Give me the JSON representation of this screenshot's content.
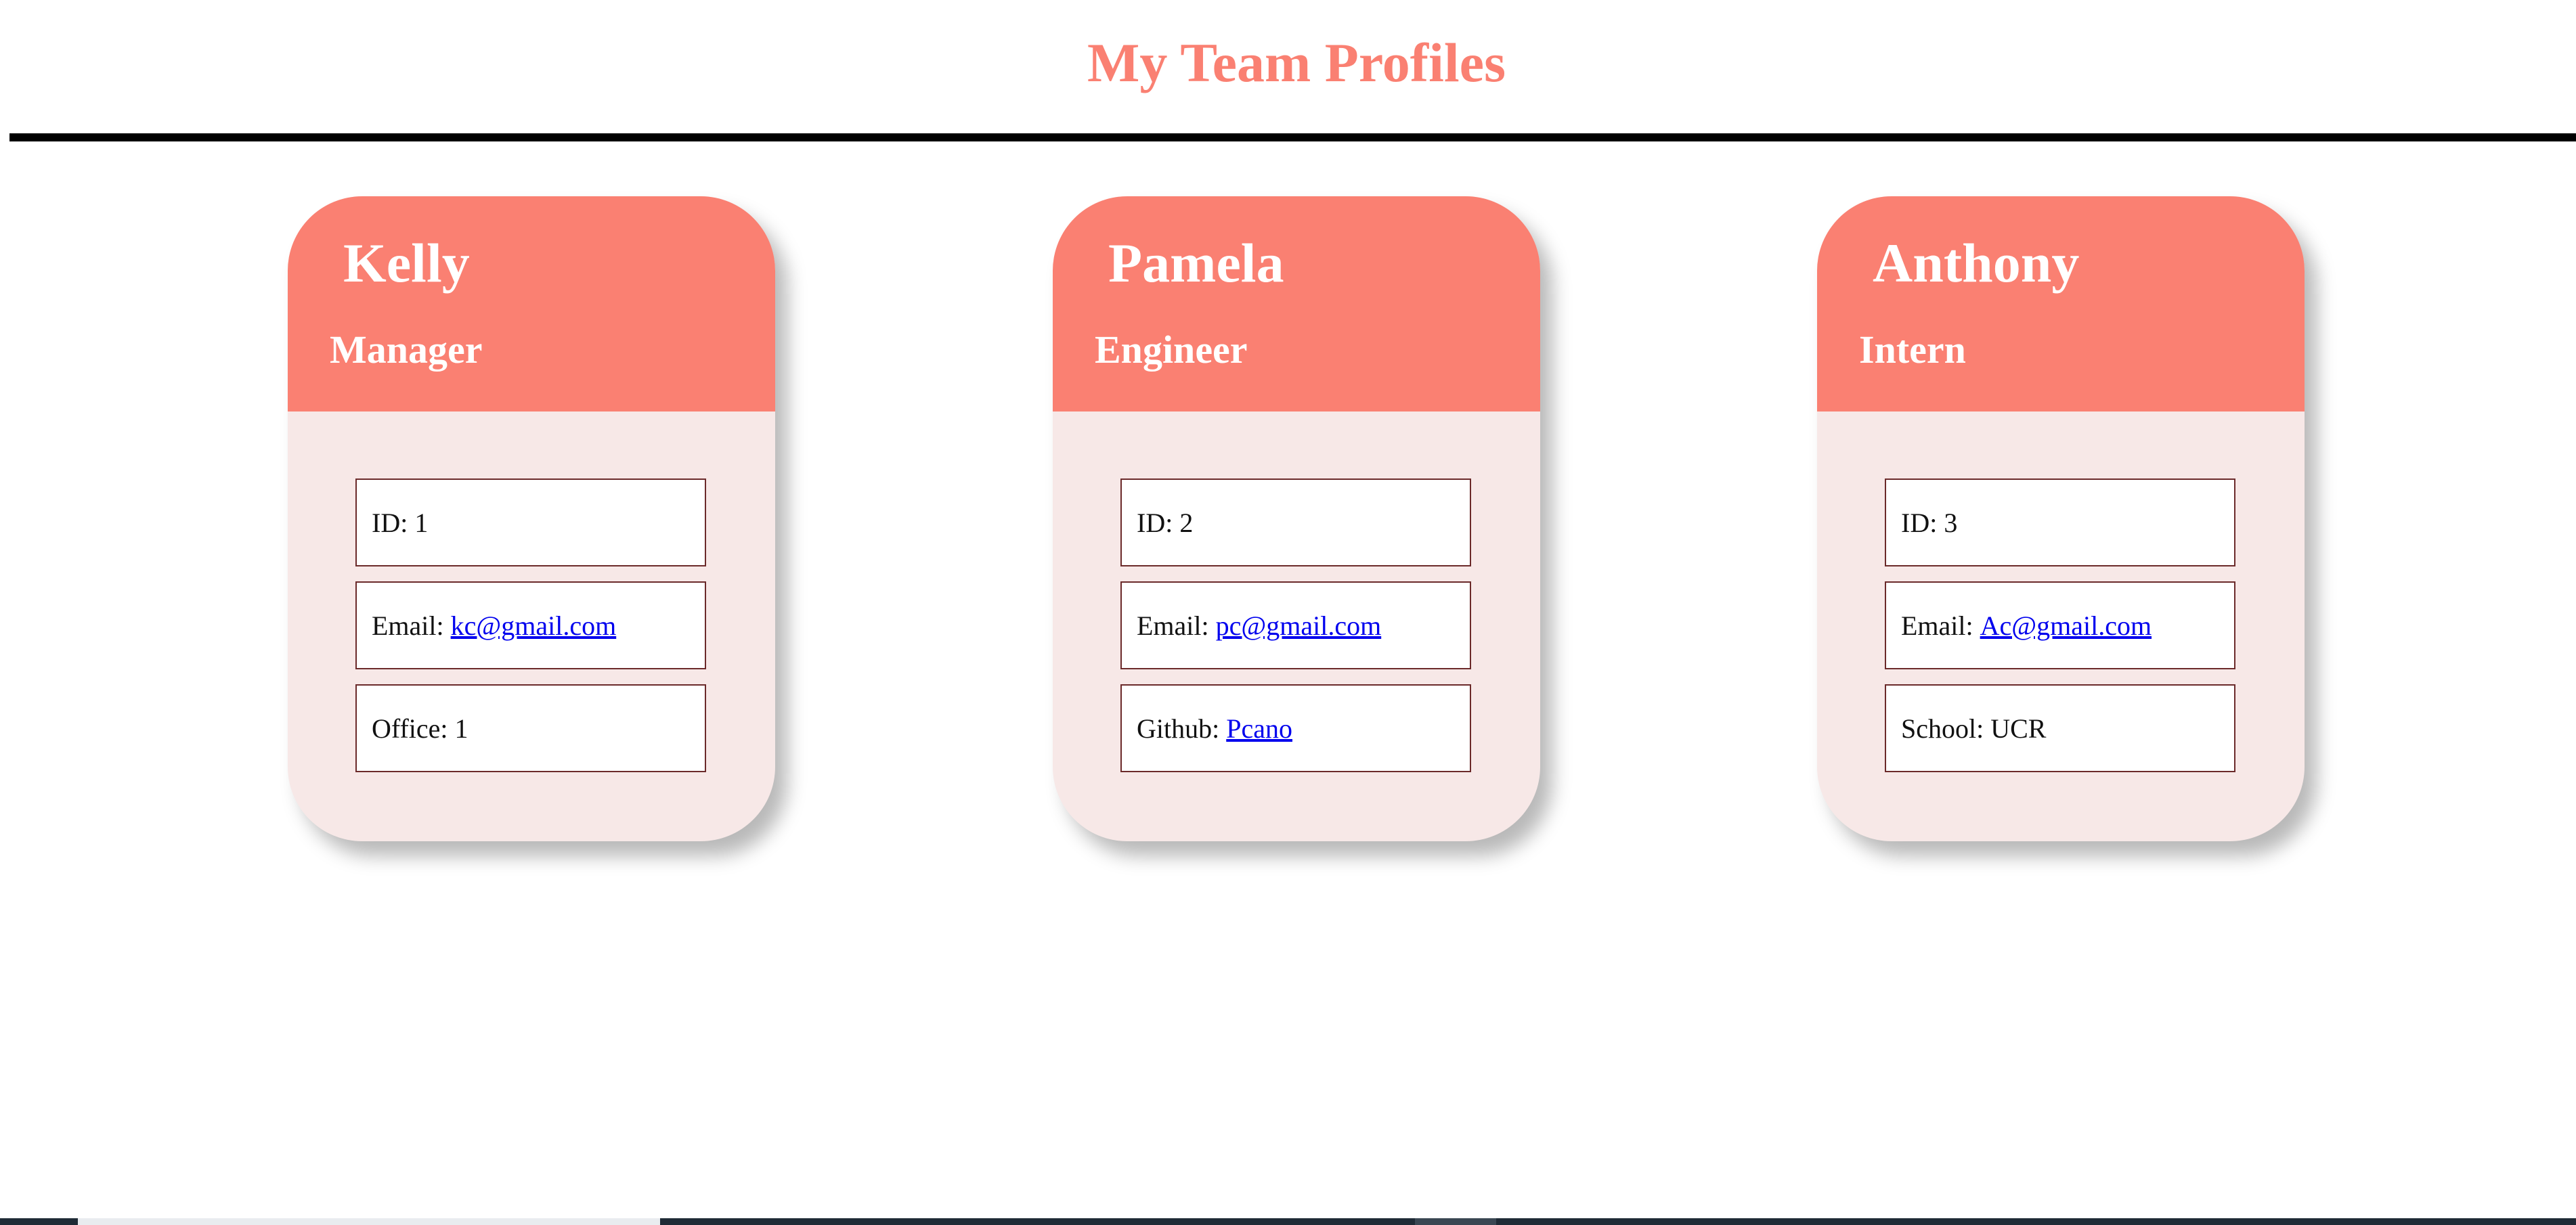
{
  "page": {
    "title": "My Team Profiles"
  },
  "colors": {
    "accent": "#fa8072",
    "card_body": "#f7e8e7",
    "link": "#0000ee",
    "divider": "#000000"
  },
  "team": [
    {
      "name": "Kelly",
      "role": "Manager",
      "id_text": "ID: 1",
      "email_label": "Email: ",
      "email": "kc@gmail.com",
      "extra_label": "Office: 1",
      "extra_link": ""
    },
    {
      "name": "Pamela",
      "role": "Engineer",
      "id_text": "ID: 2",
      "email_label": "Email: ",
      "email": "pc@gmail.com",
      "extra_label": "Github: ",
      "extra_link": "Pcano"
    },
    {
      "name": "Anthony",
      "role": "Intern",
      "id_text": "ID: 3",
      "email_label": "Email: ",
      "email": "Ac@gmail.com",
      "extra_label": "School: UCR",
      "extra_link": ""
    }
  ]
}
